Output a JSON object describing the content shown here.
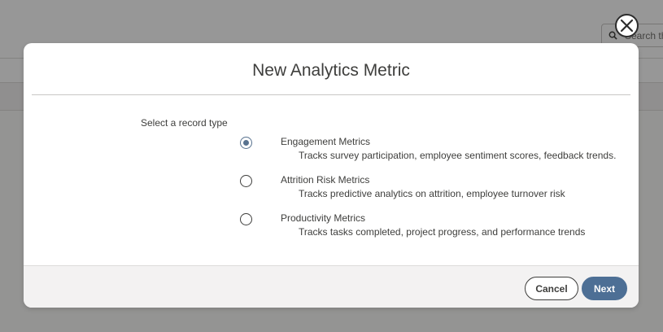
{
  "background": {
    "search_placeholder": "Search th"
  },
  "modal": {
    "title": "New Analytics Metric",
    "field_label": "Select a record type",
    "options": [
      {
        "label": "Engagement Metrics",
        "description": "Tracks survey participation, employee sentiment scores, feedback trends.",
        "selected": true
      },
      {
        "label": "Attrition Risk Metrics",
        "description": "Tracks predictive analytics on attrition, employee turnover risk",
        "selected": false
      },
      {
        "label": "Productivity Metrics",
        "description": "Tracks tasks completed, project progress, and performance trends",
        "selected": false
      }
    ],
    "cancel_label": "Cancel",
    "next_label": "Next",
    "close_icon": "close-icon"
  },
  "colors": {
    "primary": "#4d6f95",
    "radio_selected": "#58728f",
    "footer_bg": "#f3f2f2"
  }
}
